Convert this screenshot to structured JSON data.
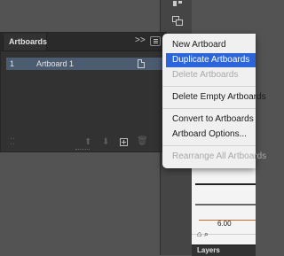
{
  "panel": {
    "tab_title": "Artboards",
    "collapse_glyph": ">>",
    "rows": [
      {
        "number": "1",
        "name": "Artboard 1"
      }
    ]
  },
  "context_menu": {
    "items": [
      {
        "label": "New Artboard",
        "state": "normal"
      },
      {
        "label": "Duplicate Artboards",
        "state": "highlighted"
      },
      {
        "label": "Delete Artboards",
        "state": "disabled"
      },
      {
        "label": "Delete Empty Artboards",
        "state": "normal"
      },
      {
        "label": "Convert to Artboards",
        "state": "normal"
      },
      {
        "label": "Artboard Options...",
        "state": "normal"
      },
      {
        "label": "Rearrange All Artboards",
        "state": "disabled"
      }
    ]
  },
  "brushes": {
    "size_value": "6.00"
  },
  "layers": {
    "tab_title": "Layers"
  },
  "icons": {
    "footer": [
      "rearrange-icon",
      "move-up-icon",
      "move-down-icon",
      "new-artboard-icon",
      "delete-icon"
    ],
    "dock": [
      "align-icon",
      "transform-icon"
    ]
  },
  "colors": {
    "highlight": "#2b65d9",
    "row_selected": "#4b5b70",
    "panel_bg": "#323232"
  }
}
